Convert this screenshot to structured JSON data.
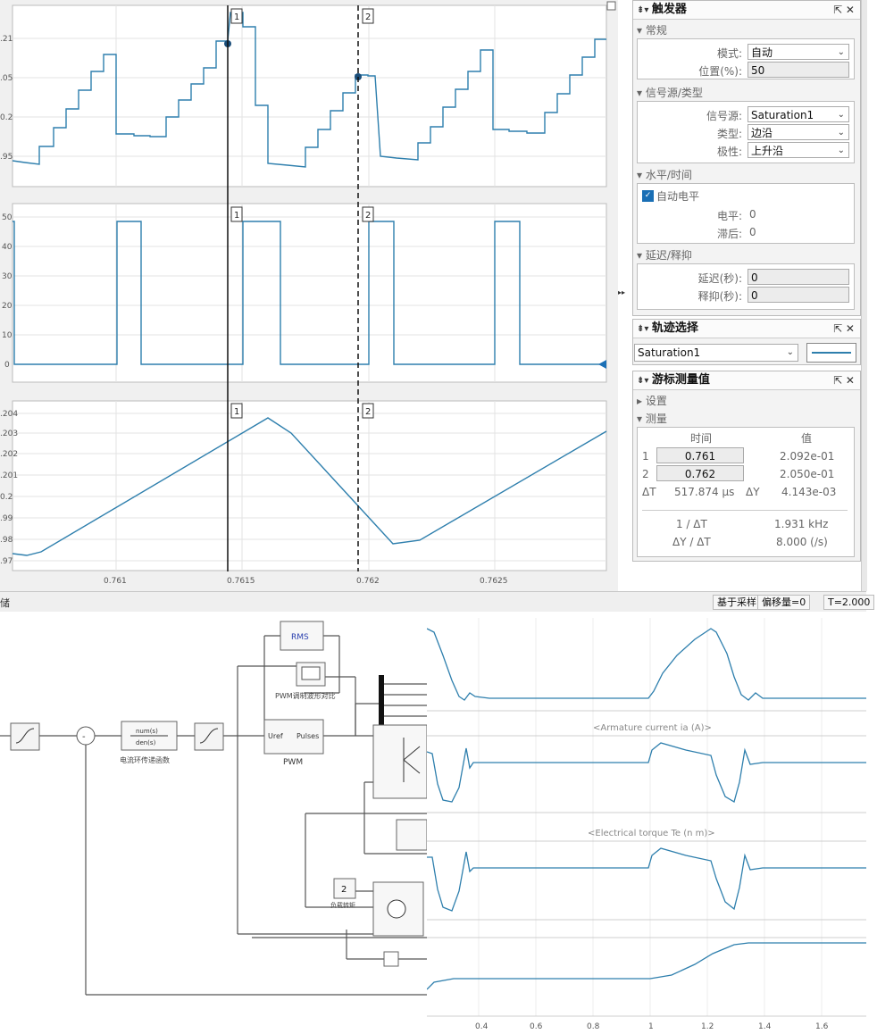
{
  "scope": {
    "panel1": {
      "ticks": [
        ".21",
        ".05",
        "0.2",
        ".95"
      ]
    },
    "panel2": {
      "ticks": [
        "50",
        "40",
        "30",
        "20",
        "10",
        "0"
      ]
    },
    "panel3": {
      "ticks": [
        ".204",
        ".203",
        ".202",
        ".201",
        "0.2",
        ".99",
        ".98",
        ".97"
      ]
    },
    "x_ticks": [
      "0.761",
      "0.7615",
      "0.762",
      "0.7625"
    ],
    "cursor1_label": "1",
    "cursor2_label": "2",
    "status_left": "储",
    "status_mode": "基于采样",
    "status_offset": "偏移量=0",
    "status_time": "T=2.000"
  },
  "trigger": {
    "title": "触发器",
    "ctl": "⇱ ✕",
    "section_general": "▾ 常规",
    "mode_label": "模式:",
    "mode_value": "自动",
    "position_label": "位置(%):",
    "position_value": "50",
    "section_source": "▾ 信号源/类型",
    "source_label": "信号源:",
    "source_value": "Saturation1",
    "type_label": "类型:",
    "type_value": "边沿",
    "polarity_label": "极性:",
    "polarity_value": "上升沿",
    "section_level": "▾ 水平/时间",
    "auto_level": "自动电平",
    "level_label": "电平:",
    "level_value": "0",
    "hyst_label": "滞后:",
    "hyst_value": "0",
    "section_delay": "▾ 延迟/释抑",
    "delay_label": "延迟(秒):",
    "delay_value": "0",
    "holdoff_label": "释抑(秒):",
    "holdoff_value": "0"
  },
  "trace": {
    "title": "轨迹选择",
    "ctl": "⇱ ✕",
    "signal": "Saturation1"
  },
  "cursor": {
    "title": "游标测量值",
    "ctl": "⇱ ✕",
    "section_settings": "▸ 设置",
    "section_measure": "▾ 测量",
    "col_time": "时间",
    "col_value": "值",
    "row1_idx": "1",
    "row1_time": "0.761",
    "row1_value": "2.092e-01",
    "row2_idx": "2",
    "row2_time": "0.762",
    "row2_value": "2.050e-01",
    "dt_label": "ΔT",
    "dt_value": "517.874 µs",
    "dy_label": "ΔY",
    "dy_value": "4.143e-03",
    "inv_dt_label": "1 / ΔT",
    "inv_dt_value": "1.931 kHz",
    "slope_label": "ΔY / ΔT",
    "slope_value": "8.000 (/s)"
  },
  "model": {
    "rms": "RMS",
    "pwm_scope_label": "PWM调制波形对比",
    "pwm_in1": "Uref",
    "pwm_out": "Pulses",
    "pwm_name": "PWM",
    "tf_line1": "num(s)",
    "tf_line2": "den(s)",
    "tf_name": "电流环传递函数",
    "const_value": "2",
    "load_label": "负载转矩"
  },
  "plot2": {
    "title_armature": "<Armature current ia (A)>",
    "title_torque": "<Electrical torque Te (n m)>",
    "x_ticks": [
      "0.4",
      "0.6",
      "0.8",
      "1",
      "1.2",
      "1.4",
      "1.6"
    ]
  },
  "colors": {
    "trace": "#2e7fad",
    "accent": "#1a6fb5"
  }
}
